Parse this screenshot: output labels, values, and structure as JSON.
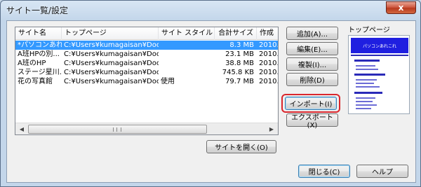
{
  "window": {
    "title": "サイト一覧/設定",
    "close_label": "x"
  },
  "list": {
    "columns": [
      "サイト名",
      "トップページ",
      "サイト スタイル",
      "合計サイズ",
      "作成"
    ],
    "rows": [
      {
        "name": "*パソコンあれ...",
        "top": "C:¥Users¥kumagaisan¥Docu...",
        "style": "",
        "size": "8.3 MB",
        "created": "2010."
      },
      {
        "name": "A班HPの別...",
        "top": "C:¥Users¥kumagaisan¥Docu...",
        "style": "",
        "size": "23.1 MB",
        "created": "2010."
      },
      {
        "name": "A班のHP",
        "top": "C:¥Users¥kumagaisan¥Docu...",
        "style": "",
        "size": "38.8 MB",
        "created": "2010."
      },
      {
        "name": "ステージ星川...",
        "top": "C:¥Users¥kumagaisan¥Docu...",
        "style": "",
        "size": "745.8 KB",
        "created": "2010."
      },
      {
        "name": "花の写真館",
        "top": "C:¥Users¥kumagaisan¥Docu...",
        "style": "使用",
        "size": "79.7 MB",
        "created": "2010."
      }
    ],
    "scroll_left": "◀",
    "scroll_right": "▶",
    "selected_index": 0
  },
  "buttons": {
    "add": "追加(A)...",
    "edit": "編集(E)...",
    "copy": "複製(I)...",
    "delete": "削除(D)",
    "import": "インポート(I)",
    "export": "エクスポート(X)",
    "open_site": "サイトを開く(O)",
    "close": "閉じる(C)",
    "help": "ヘルプ"
  },
  "preview": {
    "label": "トップページ",
    "banner_text": "パソコンあれこれ"
  },
  "colors": {
    "selection": "#3399ff",
    "highlight_ring": "#d9262c",
    "preview_banner": "#1f1fe0"
  }
}
